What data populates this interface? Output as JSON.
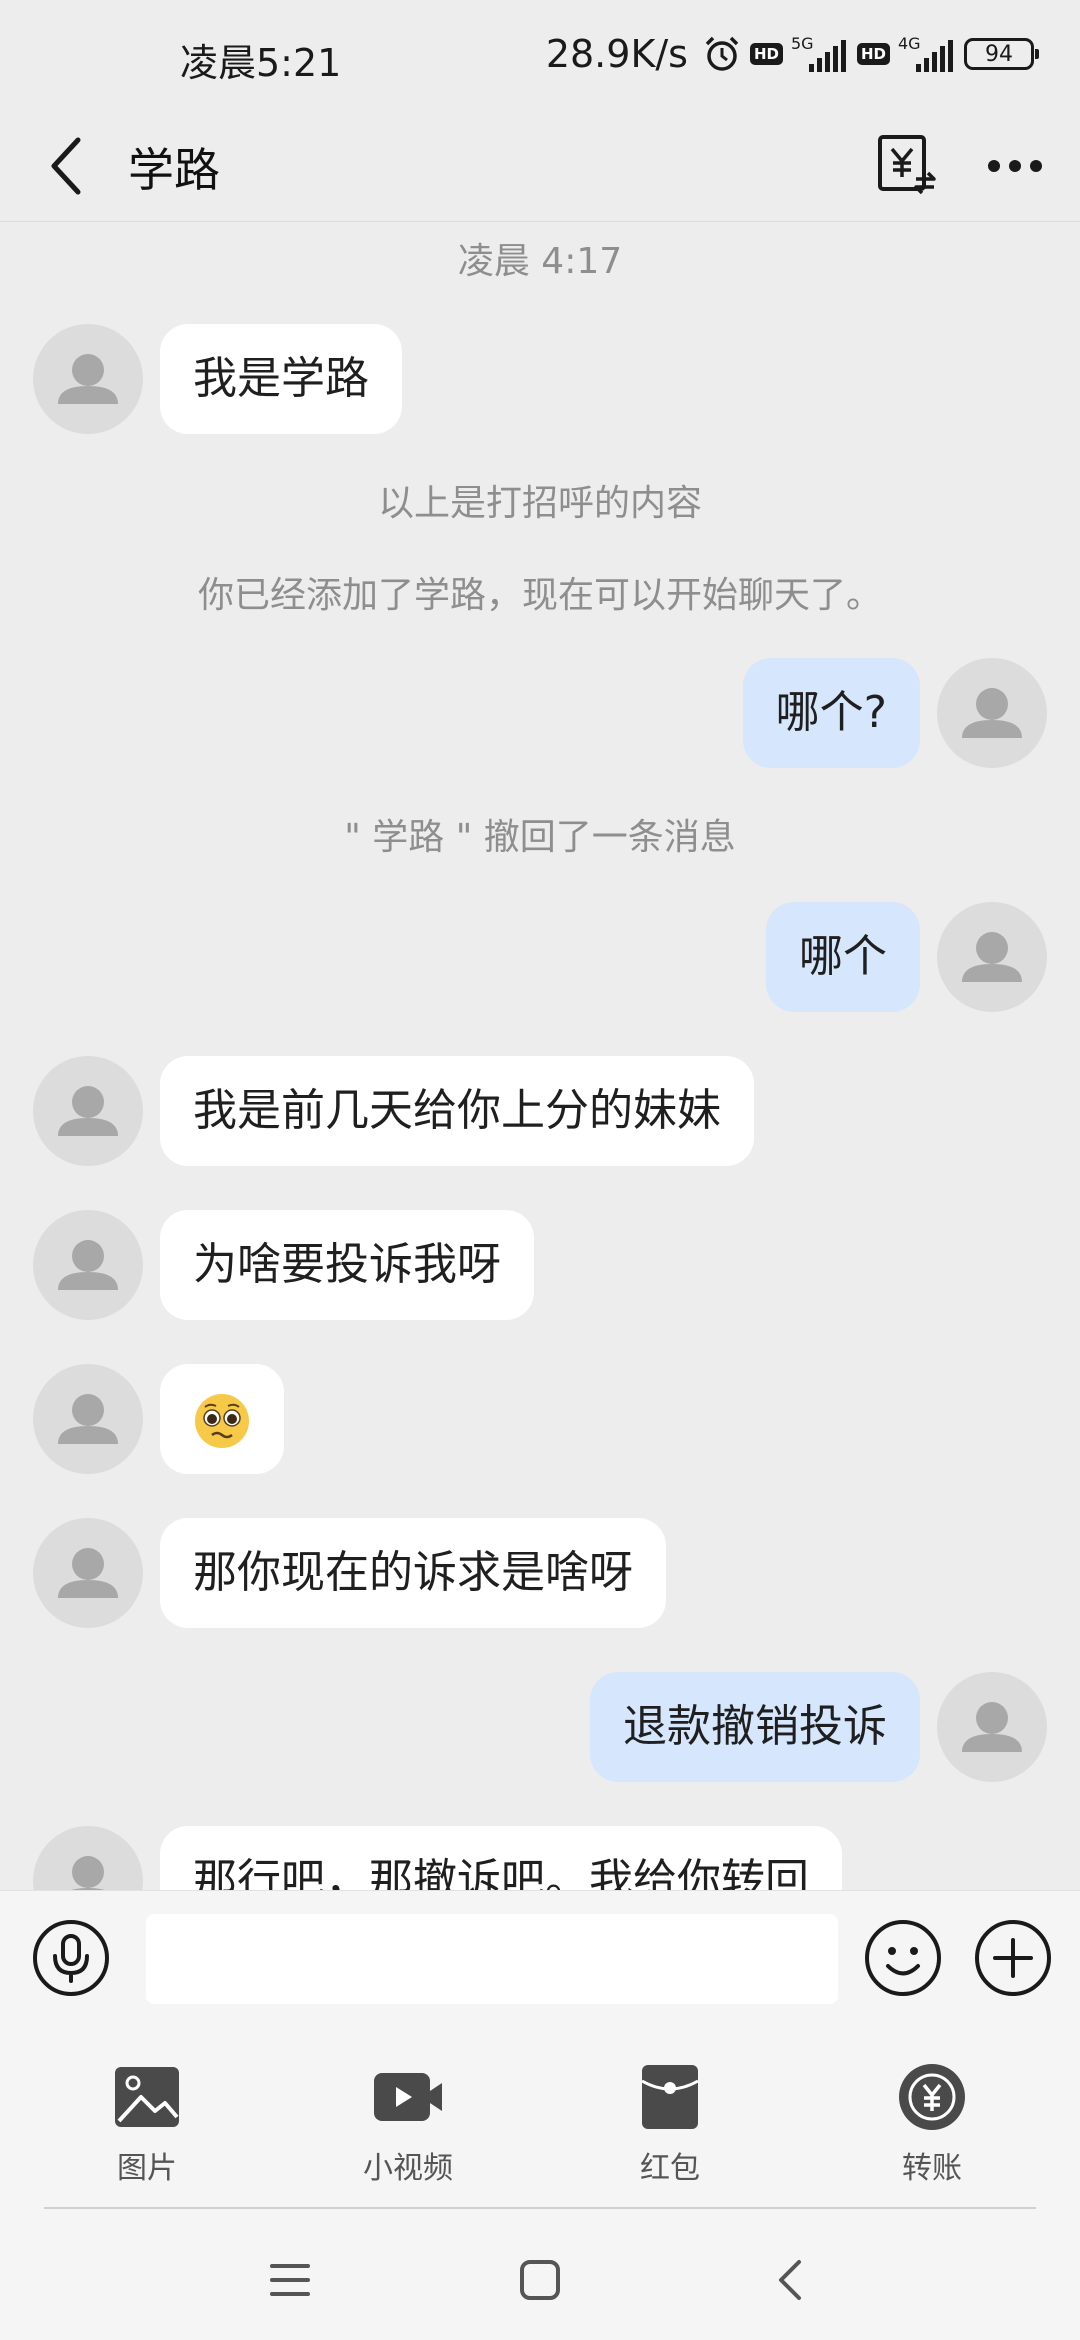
{
  "status_bar": {
    "time": "凌晨5:21",
    "net_speed": "28.9K/s",
    "hd": "HD",
    "sim1_tag": "5G",
    "sim2_tag": "4G",
    "battery": "94"
  },
  "header": {
    "title": "学路"
  },
  "messages": {
    "timestamp": "凌晨 4:17",
    "m1": "我是学路",
    "sys_greeting": "以上是打招呼的内容",
    "sys_added": "你已经添加了学路，现在可以开始聊天了。",
    "m2": "哪个?",
    "sys_recall": "\" 学路 \" 撤回了一条消息",
    "m3": "哪个",
    "m4": "我是前几天给你上分的妹妹",
    "m5": "为啥要投诉我呀",
    "m6": "🥺",
    "m7": "那你现在的诉求是啥呀",
    "m8": "退款撤销投诉",
    "m9": "那行吧，那撤诉吧。我给你转回"
  },
  "composer": {
    "input_value": "",
    "tools": [
      {
        "label": "图片",
        "icon": "image-icon"
      },
      {
        "label": "小视频",
        "icon": "video-icon"
      },
      {
        "label": "红包",
        "icon": "red-packet-icon"
      },
      {
        "label": "转账",
        "icon": "transfer-icon"
      }
    ]
  },
  "colors": {
    "background": "#EDEDED",
    "incoming_bubble": "#FFFFFF",
    "outgoing_bubble": "#D6E6FC",
    "system_text": "#8E8E8E"
  }
}
